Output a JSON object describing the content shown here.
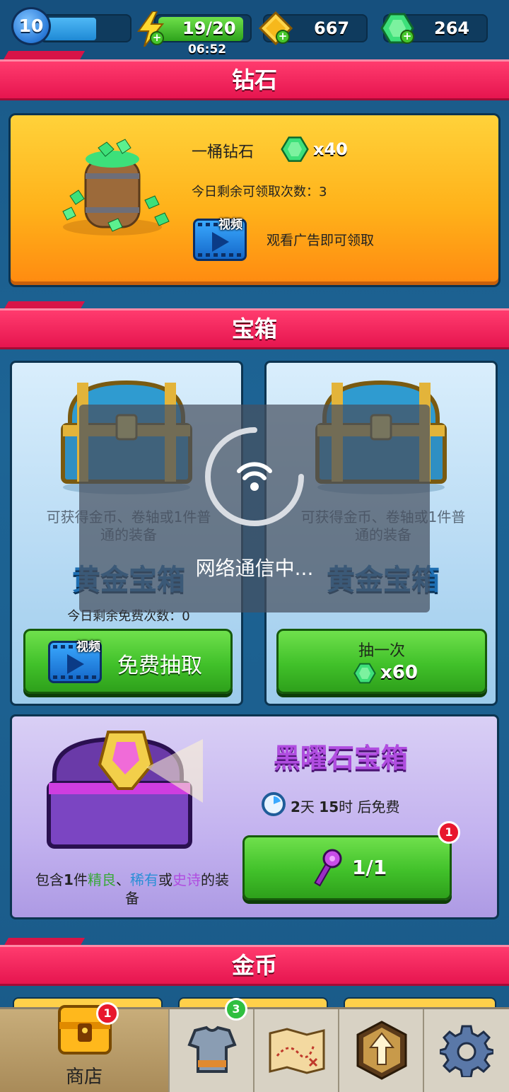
{
  "topbar": {
    "level": "10",
    "energy": "19/20",
    "energy_timer": "06:52",
    "gold": "667",
    "gems": "264"
  },
  "sections": {
    "diamond_title": "钻石",
    "chest_title": "宝箱",
    "coin_title": "金币"
  },
  "diamond_offer": {
    "name": "一桶钻石",
    "amount": "x40",
    "remaining": "今日剩余可领取次数：3",
    "video_tag": "视频",
    "hint": "观看广告即可领取"
  },
  "gold_chest_left": {
    "desc_line1": "可获得金币、卷轴或1件普",
    "desc_line2": "通的装备",
    "name": "黄金宝箱",
    "remaining": "今日剩余免费次数：0",
    "video_tag": "视频",
    "button_label": "免费抽取"
  },
  "gold_chest_right": {
    "desc_line1": "可获得金币、卷轴或1件普",
    "desc_line2": "通的装备",
    "name": "黄金宝箱",
    "button_line1": "抽一次",
    "button_cost": "x60"
  },
  "obsidian_chest": {
    "title": "黑曜石宝箱",
    "timer_days": "2",
    "timer_day_unit": "天",
    "timer_hours": "15",
    "timer_hour_unit": "时",
    "timer_suffix": "后免费",
    "desc_prefix": "包含",
    "desc_count": "1",
    "desc_word": "件",
    "desc_fine": "精良",
    "desc_sep": "、",
    "desc_rare": "稀有",
    "desc_or": "或",
    "desc_epic": "史诗",
    "desc_suffix": "的装",
    "desc_line2": "备",
    "key_count": "1/1",
    "badge": "1"
  },
  "loading": {
    "text": "网络通信中..."
  },
  "bottom_nav": {
    "shop_label": "商店",
    "shop_badge": "1",
    "equipment_badge": "3"
  },
  "colors": {
    "section_header": "#e6154f",
    "green_button": "#41c12a",
    "gem": "#3de07a",
    "rarity_fine": "#3aa83a",
    "rarity_rare": "#2a8fd6",
    "rarity_epic": "#b04de0"
  }
}
